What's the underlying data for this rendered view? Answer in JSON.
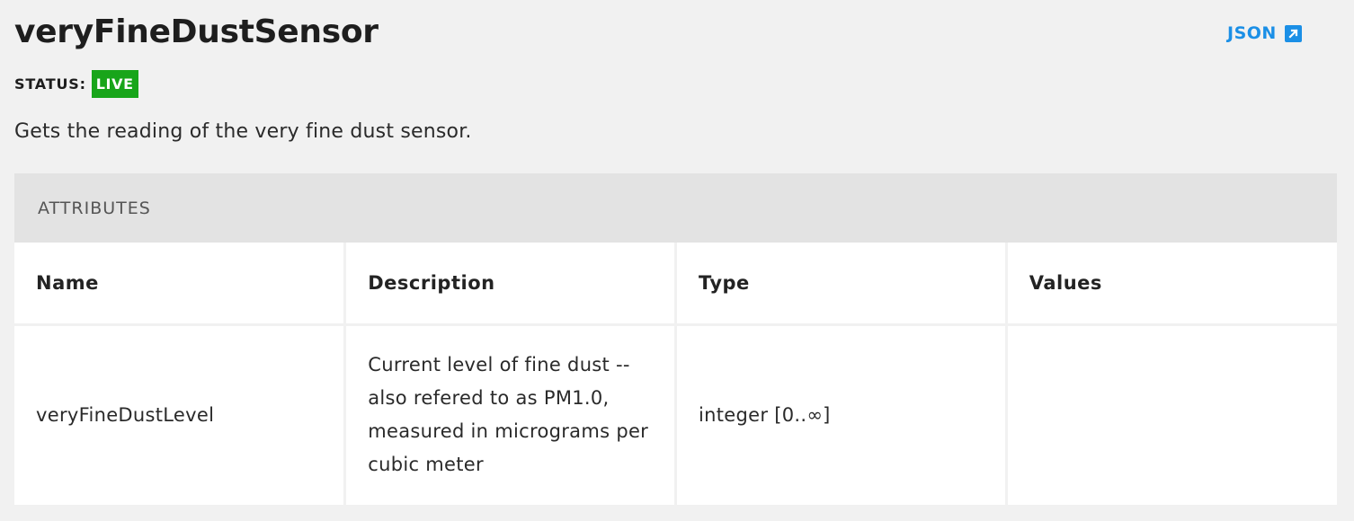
{
  "header": {
    "title": "veryFineDustSensor",
    "json_link_label": "JSON",
    "json_link_icon": "external-link-icon"
  },
  "status": {
    "label": "STATUS:",
    "value": "LIVE",
    "color": "#18a51a"
  },
  "description": "Gets the reading of the very fine dust sensor.",
  "attributes": {
    "section_title": "ATTRIBUTES",
    "columns": [
      "Name",
      "Description",
      "Type",
      "Values"
    ],
    "rows": [
      {
        "name": "veryFineDustLevel",
        "description": "Current level of fine dust -- also refered to as PM1.0, measured in micrograms per cubic meter",
        "type": "integer [0..∞]",
        "values": ""
      }
    ]
  },
  "colors": {
    "background": "#f1f1f1",
    "link": "#1b8fe6",
    "header_band": "#e3e3e3"
  }
}
